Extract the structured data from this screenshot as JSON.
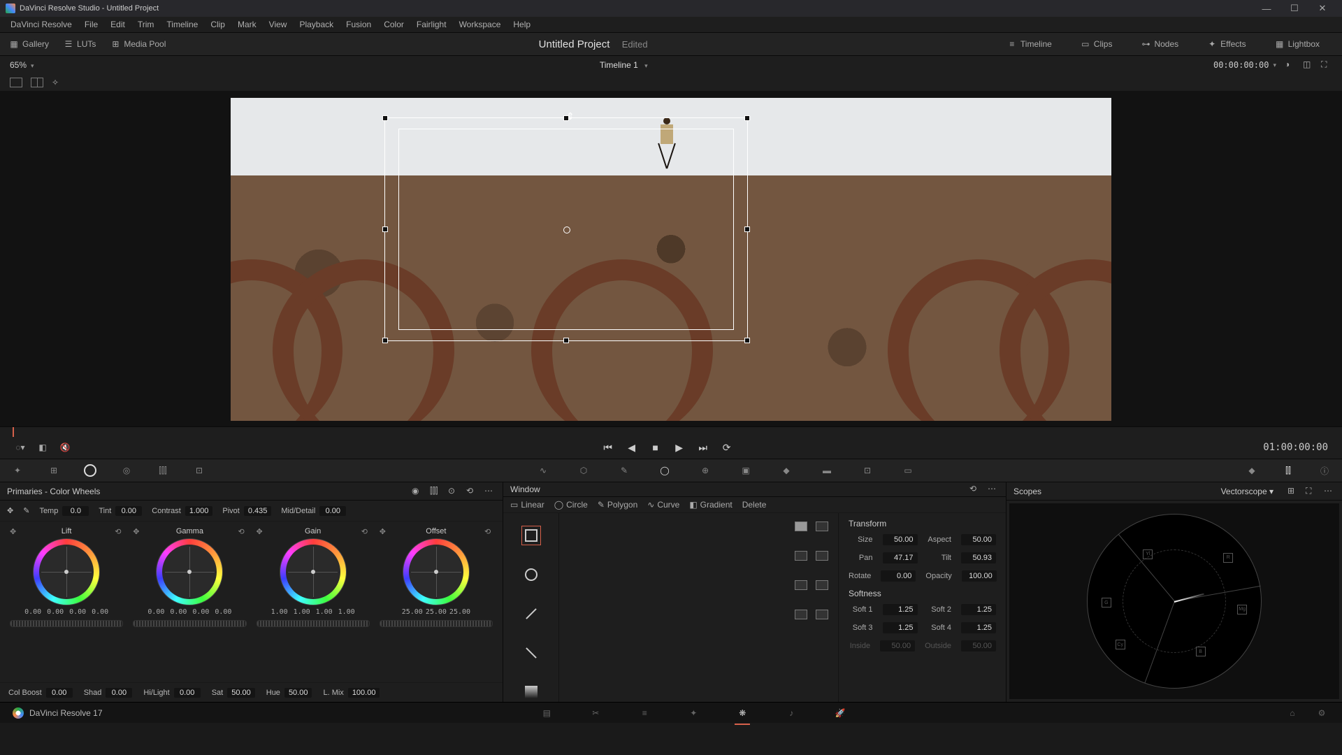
{
  "titlebar": {
    "app": "DaVinci Resolve Studio",
    "project": "Untitled Project"
  },
  "menu": {
    "items": [
      "DaVinci Resolve",
      "File",
      "Edit",
      "Trim",
      "Timeline",
      "Clip",
      "Mark",
      "View",
      "Playback",
      "Fusion",
      "Color",
      "Fairlight",
      "Workspace",
      "Help"
    ]
  },
  "top_toolbar": {
    "left": [
      {
        "name": "gallery",
        "label": "Gallery"
      },
      {
        "name": "luts",
        "label": "LUTs"
      },
      {
        "name": "mediapool",
        "label": "Media Pool"
      }
    ],
    "project": "Untitled Project",
    "status": "Edited",
    "right": [
      {
        "name": "timeline",
        "label": "Timeline"
      },
      {
        "name": "clips",
        "label": "Clips"
      },
      {
        "name": "nodes",
        "label": "Nodes"
      },
      {
        "name": "effects",
        "label": "Effects"
      },
      {
        "name": "lightbox",
        "label": "Lightbox"
      }
    ]
  },
  "viewer": {
    "zoom": "65%",
    "timeline_name": "Timeline 1",
    "timecode": "00:00:00:00"
  },
  "transport": {
    "record_tc": "01:00:00:00"
  },
  "primaries": {
    "title": "Primaries - Color Wheels",
    "row1": {
      "temp": "0.0",
      "tint": "0.00",
      "contrast": "1.000",
      "pivot": "0.435",
      "middetail": "0.00"
    },
    "wheels": [
      {
        "name": "Lift",
        "vals": [
          "0.00",
          "0.00",
          "0.00",
          "0.00"
        ]
      },
      {
        "name": "Gamma",
        "vals": [
          "0.00",
          "0.00",
          "0.00",
          "0.00"
        ]
      },
      {
        "name": "Gain",
        "vals": [
          "1.00",
          "1.00",
          "1.00",
          "1.00"
        ]
      },
      {
        "name": "Offset",
        "vals": [
          "25.00",
          "25.00",
          "25.00"
        ]
      }
    ],
    "row2": {
      "colboost": "0.00",
      "shad": "0.00",
      "hilight": "0.00",
      "sat": "50.00",
      "hue": "50.00",
      "lmix": "100.00"
    }
  },
  "window": {
    "title": "Window",
    "tools": [
      "Linear",
      "Circle",
      "Polygon",
      "Curve",
      "Gradient",
      "Delete"
    ],
    "transform": {
      "title": "Transform",
      "size": "50.00",
      "aspect": "50.00",
      "pan": "47.17",
      "tilt": "50.93",
      "rotate": "0.00",
      "opacity": "100.00"
    },
    "softness": {
      "title": "Softness",
      "soft1": "1.25",
      "soft2": "1.25",
      "soft3": "1.25",
      "soft4": "1.25",
      "inside": "50.00",
      "outside": "50.00"
    }
  },
  "scopes": {
    "title": "Scopes",
    "selected": "Vectorscope"
  },
  "labels": {
    "temp": "Temp",
    "tint": "Tint",
    "contrast": "Contrast",
    "pivot": "Pivot",
    "middetail": "Mid/Detail",
    "colboost": "Col Boost",
    "shad": "Shad",
    "hilight": "Hi/Light",
    "sat": "Sat",
    "hue": "Hue",
    "lmix": "L. Mix",
    "size": "Size",
    "aspect": "Aspect",
    "pan": "Pan",
    "tilt": "Tilt",
    "rotate": "Rotate",
    "opacity": "Opacity",
    "soft1": "Soft 1",
    "soft2": "Soft 2",
    "soft3": "Soft 3",
    "soft4": "Soft 4",
    "inside": "Inside",
    "outside": "Outside"
  },
  "page_switcher": {
    "app_label": "DaVinci Resolve 17"
  }
}
